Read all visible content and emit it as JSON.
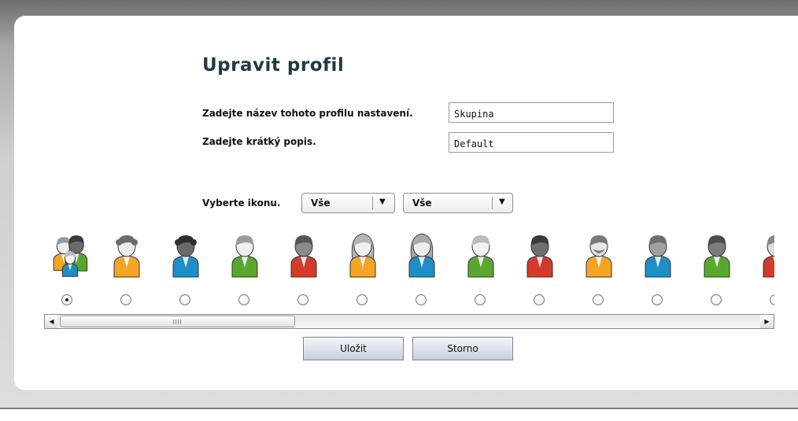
{
  "page": {
    "title": "Upravit profil"
  },
  "form": {
    "name_label": "Zadejte název tohoto profilu nastavení.",
    "name_value": "Skupina",
    "description_label": "Zadejte krátký popis.",
    "description_value": "Default",
    "icon_label": "Vyberte ikonu.",
    "filter_1": {
      "selected": "Vše"
    },
    "filter_2": {
      "selected": "Vše"
    }
  },
  "icons": [
    {
      "name": "group-icon",
      "selected": true
    },
    {
      "name": "woman-curly-orange-icon",
      "selected": false
    },
    {
      "name": "woman-dark-blue-icon",
      "selected": false
    },
    {
      "name": "woman-light-green-icon",
      "selected": false
    },
    {
      "name": "woman-dark-red-icon",
      "selected": false
    },
    {
      "name": "woman-long-hair-orange-icon",
      "selected": false
    },
    {
      "name": "woman-long-hair-blue-icon",
      "selected": false
    },
    {
      "name": "man-light-green-icon",
      "selected": false
    },
    {
      "name": "man-dark-red-icon",
      "selected": false
    },
    {
      "name": "man-beard-orange-icon",
      "selected": false
    },
    {
      "name": "man-gray-blue-icon",
      "selected": false
    },
    {
      "name": "man-dark-green-icon",
      "selected": false
    },
    {
      "name": "man-red-icon",
      "selected": false
    }
  ],
  "colors": {
    "orange": "#f5a524",
    "blue": "#1e8fc6",
    "green": "#5aa72e",
    "red": "#d43a2a",
    "title": "#1f3b44"
  },
  "buttons": {
    "save_label": "Uložit",
    "cancel_label": "Storno"
  }
}
